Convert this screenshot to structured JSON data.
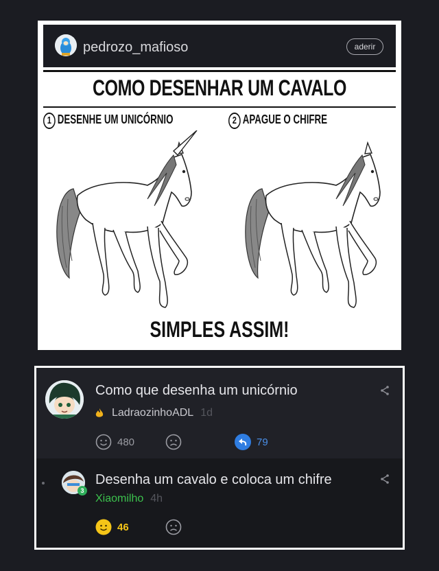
{
  "post": {
    "username": "pedrozo_mafioso",
    "join_label": "aderir",
    "meme": {
      "title": "COMO DESENHAR UM CAVALO",
      "step1_number": "1",
      "step1_label": "DESENHE UM UNICÓRNIO",
      "step2_number": "2",
      "step2_label": "APAGUE O CHIFRE",
      "caption": "SIMPLES ASSIM!"
    }
  },
  "comments": [
    {
      "text": "Como que desenha um unicórnio",
      "author": "LadraozinhoADL",
      "time": "1d",
      "likes": "480",
      "replies": "79",
      "author_icon": "flame-icon"
    },
    {
      "text": "Desenha um cavalo e coloca um chifre",
      "author": "Xiaomilho",
      "time": "4h",
      "likes": "46",
      "level": "3",
      "author_color": "#3cc24d"
    }
  ],
  "colors": {
    "background": "#1b1c22",
    "reply_accent": "#2f7de1",
    "like_active": "#f5c518",
    "level_badge": "#2fae5a"
  }
}
